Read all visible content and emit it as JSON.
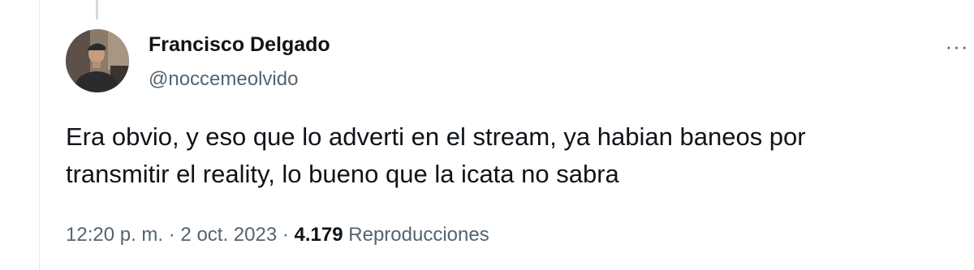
{
  "tweet": {
    "author_name": "Francisco Delgado",
    "author_handle": "@noccemeolvido",
    "more_label": "···",
    "text_lines": [
      "Era obvio, y eso que lo adverti en el stream, ya habian baneos por",
      "transmitir el reality, lo bueno que la icata no sabra"
    ],
    "time": "12:20 p. m.",
    "separator": "·",
    "date": "2 oct. 2023",
    "views_count": "4.179",
    "views_label": "Reproducciones"
  },
  "colors": {
    "text_primary": "#0f1419",
    "text_secondary": "#536471",
    "thread_line": "#cfd9de"
  }
}
